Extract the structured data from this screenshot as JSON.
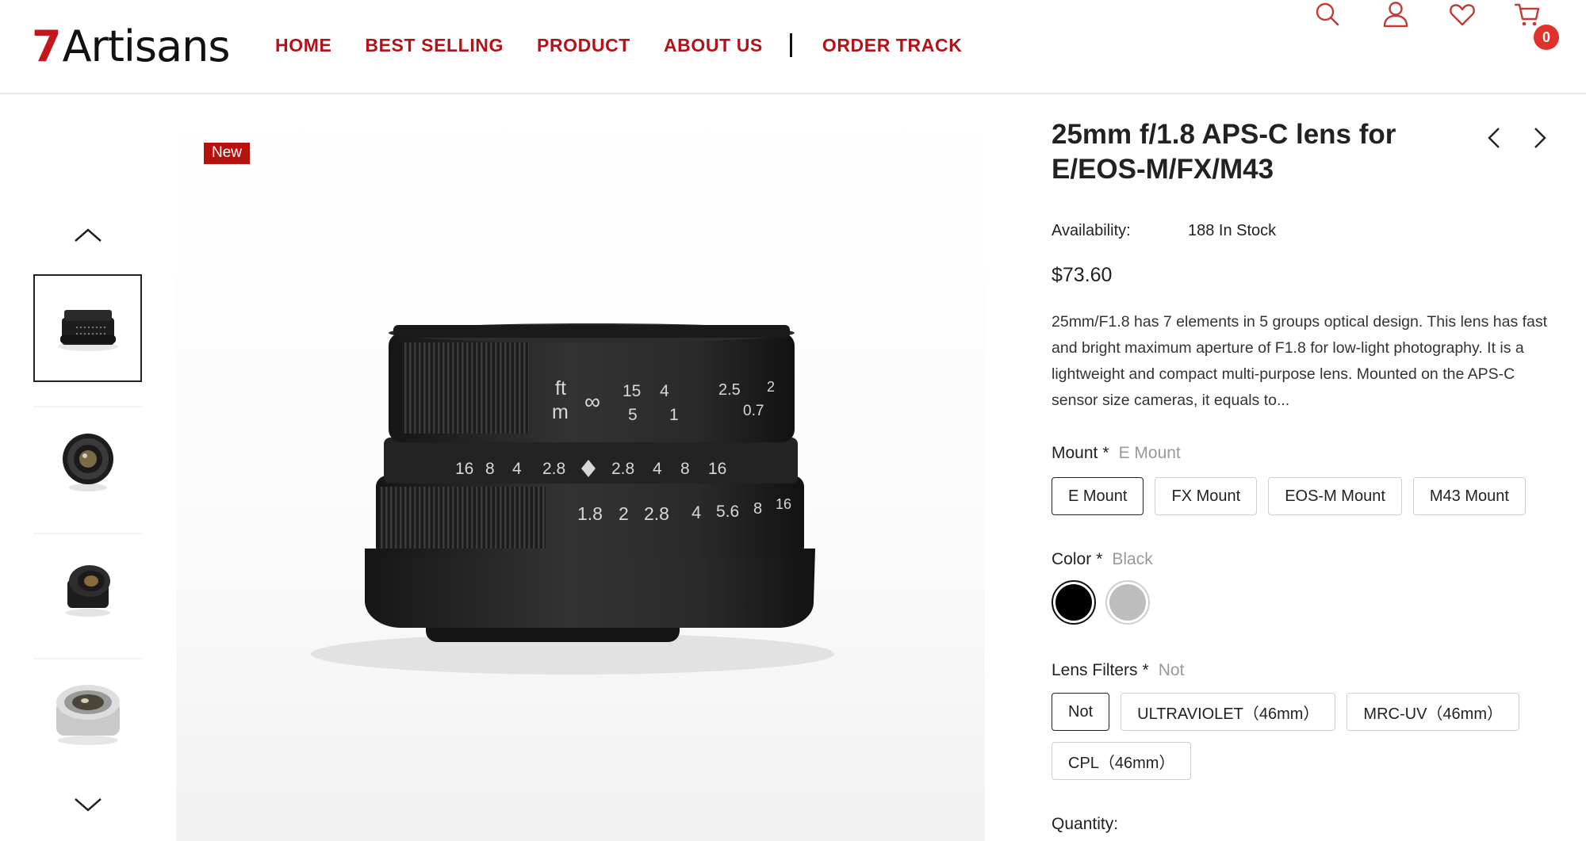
{
  "header": {
    "logo_seven": "7",
    "logo_text": "Artisans",
    "nav": [
      "HOME",
      "BEST SELLING",
      "PRODUCT",
      "ABOUT US",
      "ORDER TRACK"
    ],
    "cart_count": "0",
    "icons": [
      "search-icon",
      "account-icon",
      "wishlist-heart-icon",
      "cart-icon"
    ]
  },
  "gallery": {
    "badge": "New",
    "thumbnails": [
      "black-front",
      "black-rear",
      "black-angle",
      "silver-angle"
    ]
  },
  "product": {
    "title": "25mm f/1.8 APS-C lens for E/EOS-M/FX/M43",
    "availability_label": "Availability:",
    "availability_value": "188 In Stock",
    "price": "$73.60",
    "description": "25mm/F1.8 has 7 elements in 5 groups optical design. This lens has fast and bright maximum aperture of F1.8 for low-light photography. It is a lightweight and compact multi-purpose lens. Mounted on the APS-C sensor size cameras, it equals to...",
    "mount": {
      "label": "Mount",
      "required": "*",
      "selected": "E Mount",
      "options": [
        "E Mount",
        "FX Mount",
        "EOS-M Mount",
        "M43 Mount"
      ]
    },
    "color": {
      "label": "Color",
      "required": "*",
      "selected": "Black",
      "options": [
        {
          "name": "Black",
          "hex": "#000000"
        },
        {
          "name": "Silver",
          "hex": "#bdbdbd"
        }
      ]
    },
    "filters": {
      "label": "Lens Filters",
      "required": "*",
      "selected": "Not",
      "options": [
        "Not",
        "ULTRAVIOLET（46mm）",
        "MRC-UV（46mm）",
        "CPL（46mm）"
      ]
    },
    "quantity_label": "Quantity:"
  },
  "lens_markings": {
    "ft": "ft",
    "m": "m",
    "inf": "∞",
    "ft_scale": [
      "15",
      "4",
      "2.5",
      "2"
    ],
    "m_scale": [
      "5",
      "1",
      "0.7"
    ],
    "dof": [
      "16",
      "8",
      "4",
      "2.8",
      "2.8",
      "4",
      "8",
      "16"
    ],
    "aperture": [
      "1.8",
      "2",
      "2.8",
      "4",
      "5.6",
      "8",
      "16"
    ]
  },
  "colors": {
    "brand_red": "#b51218",
    "badge_red": "#e0322a"
  }
}
